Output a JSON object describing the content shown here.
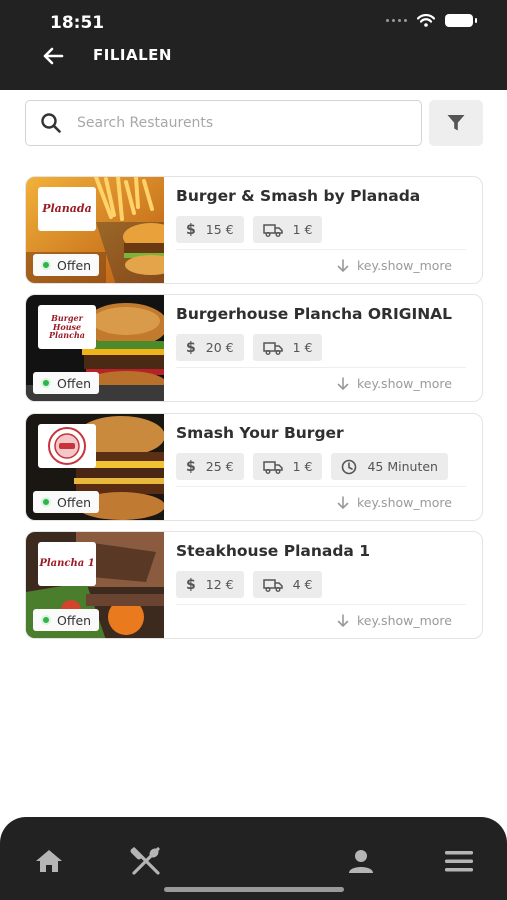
{
  "status_bar": {
    "time": "18:51"
  },
  "header": {
    "title": "FILIALEN",
    "back_icon": "arrow-left-icon"
  },
  "search": {
    "placeholder": "Search Restaurents",
    "value": "",
    "filter_icon": "filter-icon"
  },
  "restaurants": [
    {
      "name": "Burger & Smash by Planada",
      "logo_text": "Planada",
      "status": "Offen",
      "min_order": "15 €",
      "delivery_fee": "1 €",
      "show_more": "key.show_more"
    },
    {
      "name": "Burgerhouse Plancha ORIGINAL",
      "logo_text": "Burger House Plancha",
      "status": "Offen",
      "min_order": "20 €",
      "delivery_fee": "1 €",
      "show_more": "key.show_more"
    },
    {
      "name": "Smash Your Burger",
      "logo_text": "",
      "status": "Offen",
      "min_order": "25 €",
      "delivery_fee": "1 €",
      "delivery_time": "45 Minuten",
      "show_more": "key.show_more"
    },
    {
      "name": "Steakhouse Planada 1",
      "logo_text": "Plancha 1",
      "status": "Offen",
      "min_order": "12 €",
      "delivery_fee": "4 €",
      "show_more": "key.show_more"
    }
  ],
  "bottom_nav": {
    "items": [
      "home-icon",
      "restaurant-utensils-icon",
      "user-icon",
      "menu-icon"
    ]
  },
  "colors": {
    "header_bg": "#222222",
    "open_green": "#2fb44a",
    "chip_bg": "#ececec"
  }
}
